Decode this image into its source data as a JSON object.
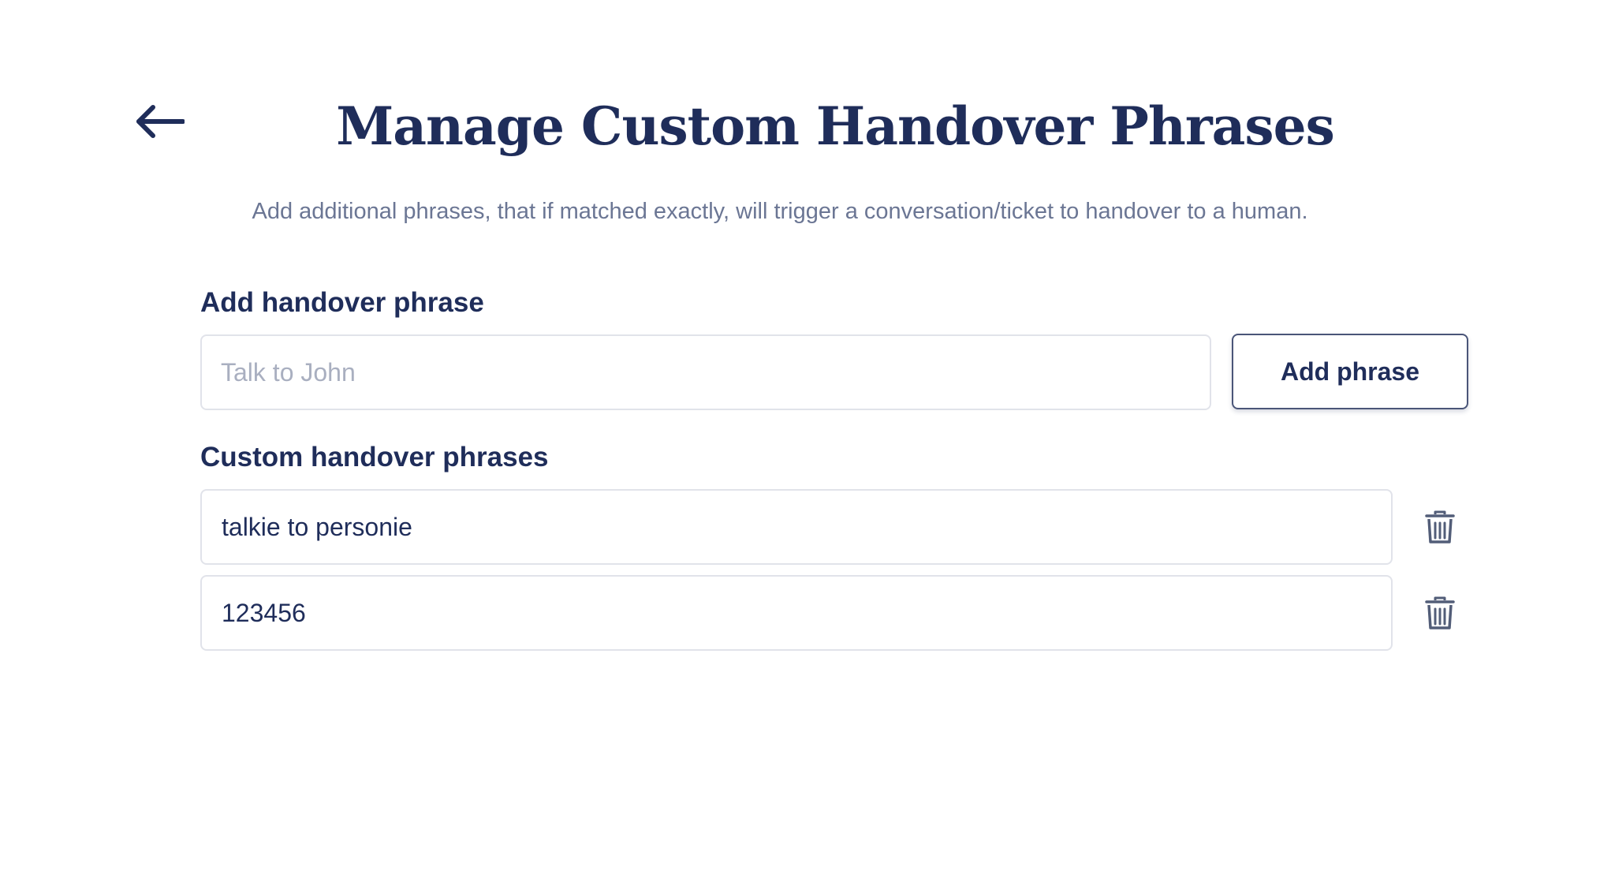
{
  "header": {
    "back_icon": "arrow-left-icon",
    "title": "Manage Custom Handover Phrases",
    "subtitle": "Add additional phrases, that if matched exactly, will trigger a conversation/ticket to handover to a human."
  },
  "add_section": {
    "heading": "Add handover phrase",
    "input_value": "",
    "input_placeholder": "Talk to John",
    "button_label": "Add phrase"
  },
  "list_section": {
    "heading": "Custom handover phrases",
    "items": [
      {
        "text": "talkie to personie",
        "delete_icon": "trash-icon"
      },
      {
        "text": "123456",
        "delete_icon": "trash-icon"
      }
    ]
  },
  "colors": {
    "primary_text": "#1f2d5a",
    "muted_text": "#6b7694",
    "placeholder_text": "#a9afc0",
    "border": "#e1e3ea",
    "icon": "#525d78"
  }
}
